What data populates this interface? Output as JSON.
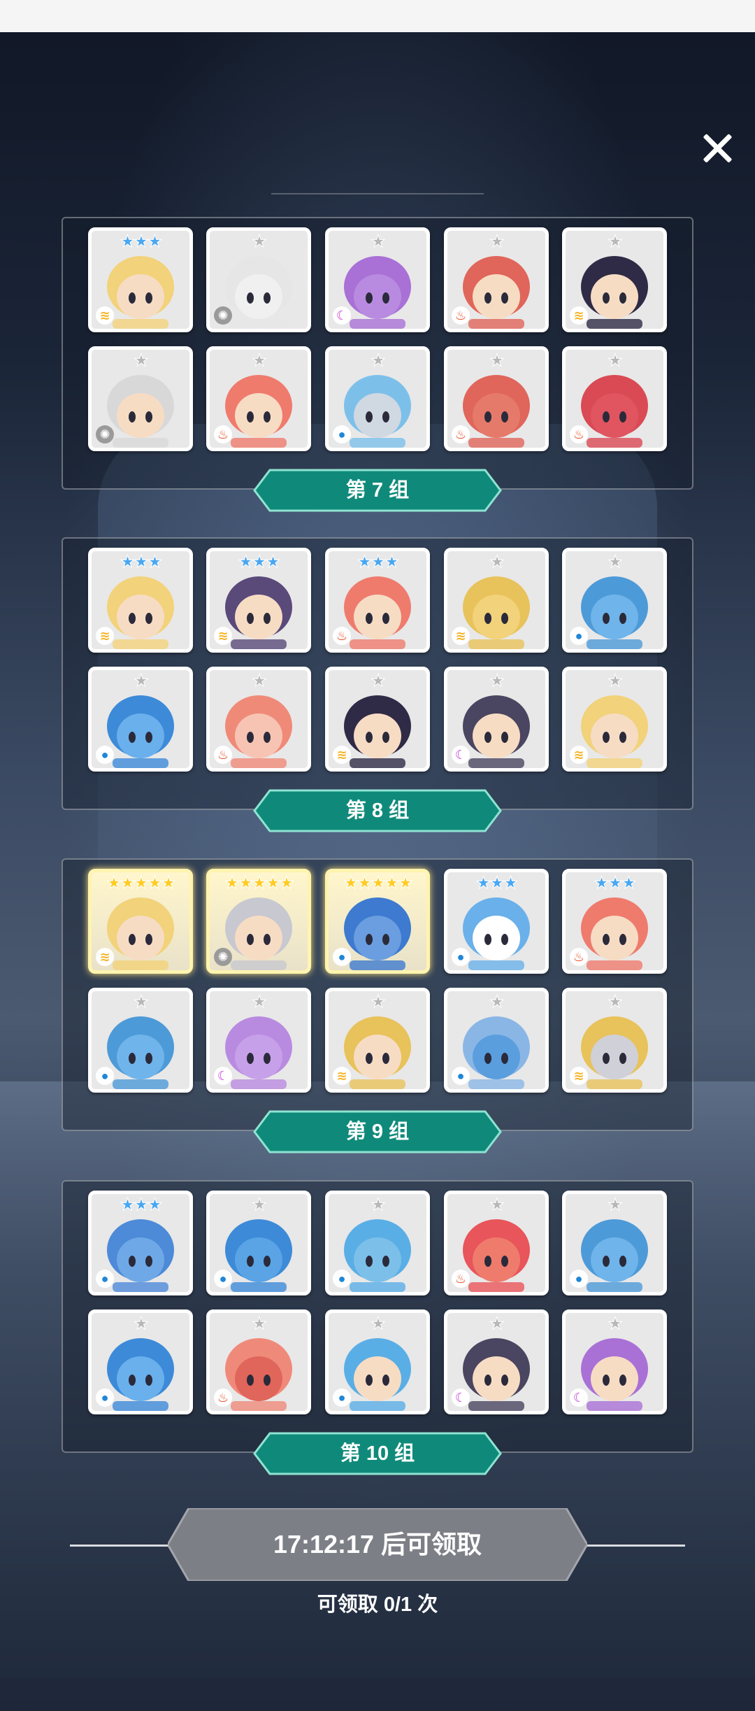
{
  "groups": [
    {
      "label": "第 7 组",
      "heroes": [
        {
          "stars": 3,
          "star_color": "blue",
          "element": "wind",
          "hair": "#f2d27a",
          "skin": "#f7dcc4"
        },
        {
          "stars": 1,
          "star_color": "gray",
          "element": "light",
          "hair": "#e6e6e6",
          "skin": "#f0f0f0"
        },
        {
          "stars": 1,
          "star_color": "gray",
          "element": "dark",
          "hair": "#a970d6",
          "skin": "#b98be0"
        },
        {
          "stars": 1,
          "star_color": "gray",
          "element": "fire",
          "hair": "#e0655a",
          "skin": "#f7dcc4"
        },
        {
          "stars": 1,
          "star_color": "gray",
          "element": "wind",
          "hair": "#2f2a45",
          "skin": "#f7dcc4"
        },
        {
          "stars": 1,
          "star_color": "gray",
          "element": "light",
          "hair": "#d8d8d8",
          "skin": "#f7dcc4"
        },
        {
          "stars": 1,
          "star_color": "gray",
          "element": "fire",
          "hair": "#ef7b6d",
          "skin": "#f7dcc4"
        },
        {
          "stars": 1,
          "star_color": "gray",
          "element": "water",
          "hair": "#7cc0ea",
          "skin": "#d0d8e2"
        },
        {
          "stars": 1,
          "star_color": "gray",
          "element": "fire",
          "hair": "#e0655a",
          "skin": "#e67a6a"
        },
        {
          "stars": 1,
          "star_color": "gray",
          "element": "fire",
          "hair": "#d94a55",
          "skin": "#e0555f"
        }
      ]
    },
    {
      "label": "第 8 组",
      "heroes": [
        {
          "stars": 3,
          "star_color": "blue",
          "element": "wind",
          "hair": "#f2d27a",
          "skin": "#f7dcc4"
        },
        {
          "stars": 3,
          "star_color": "blue",
          "element": "wind",
          "hair": "#5a4a7a",
          "skin": "#f7dcc4"
        },
        {
          "stars": 3,
          "star_color": "blue",
          "element": "fire",
          "hair": "#ef7b6d",
          "skin": "#f7dcc4"
        },
        {
          "stars": 1,
          "star_color": "gray",
          "element": "wind",
          "hair": "#e8c25a",
          "skin": "#f2d27a"
        },
        {
          "stars": 1,
          "star_color": "gray",
          "element": "water",
          "hair": "#4d9ad8",
          "skin": "#6fb4ea"
        },
        {
          "stars": 1,
          "star_color": "gray",
          "element": "water",
          "hair": "#3d8ad8",
          "skin": "#69b0ec"
        },
        {
          "stars": 1,
          "star_color": "gray",
          "element": "fire",
          "hair": "#f08a78",
          "skin": "#f7c4b4"
        },
        {
          "stars": 1,
          "star_color": "gray",
          "element": "wind",
          "hair": "#2f2a45",
          "skin": "#f7dcc4"
        },
        {
          "stars": 1,
          "star_color": "gray",
          "element": "dark",
          "hair": "#4a4560",
          "skin": "#f7dcc4"
        },
        {
          "stars": 1,
          "star_color": "gray",
          "element": "wind",
          "hair": "#f2d27a",
          "skin": "#f7dcc4"
        }
      ]
    },
    {
      "label": "第 9 组",
      "heroes": [
        {
          "stars": 5,
          "star_color": "gold",
          "element": "wind",
          "hair": "#f2d27a",
          "skin": "#f7dcc4",
          "gold": true
        },
        {
          "stars": 5,
          "star_color": "gold",
          "element": "light",
          "hair": "#c8c8d0",
          "skin": "#f7dcc4",
          "gold": true
        },
        {
          "stars": 5,
          "star_color": "gold",
          "element": "water",
          "hair": "#3d7ad0",
          "skin": "#6a9ee0",
          "gold": true
        },
        {
          "stars": 3,
          "star_color": "blue",
          "element": "water",
          "hair": "#6ab0ea",
          "skin": "#ffffff"
        },
        {
          "stars": 3,
          "star_color": "blue",
          "element": "fire",
          "hair": "#ef7b6d",
          "skin": "#f7dcc4"
        },
        {
          "stars": 1,
          "star_color": "gray",
          "element": "water",
          "hair": "#4d9ad8",
          "skin": "#6fb4ea"
        },
        {
          "stars": 1,
          "star_color": "gray",
          "element": "dark",
          "hair": "#b98be0",
          "skin": "#c7a0ea"
        },
        {
          "stars": 1,
          "star_color": "gray",
          "element": "wind",
          "hair": "#e8c25a",
          "skin": "#f7dcc4"
        },
        {
          "stars": 1,
          "star_color": "gray",
          "element": "water",
          "hair": "#8ab6e6",
          "skin": "#5a9ede"
        },
        {
          "stars": 1,
          "star_color": "gray",
          "element": "wind",
          "hair": "#e8c25a",
          "skin": "#d0d0d8"
        }
      ]
    },
    {
      "label": "第 10 组",
      "heroes": [
        {
          "stars": 3,
          "star_color": "blue",
          "element": "water",
          "hair": "#4d8ad8",
          "skin": "#6fa8e6"
        },
        {
          "stars": 1,
          "star_color": "gray",
          "element": "water",
          "hair": "#3d8ad8",
          "skin": "#5aa4e6"
        },
        {
          "stars": 1,
          "star_color": "gray",
          "element": "water",
          "hair": "#5aaee6",
          "skin": "#7cc0ea"
        },
        {
          "stars": 1,
          "star_color": "gray",
          "element": "fire",
          "hair": "#e8555a",
          "skin": "#ef7b6d"
        },
        {
          "stars": 1,
          "star_color": "gray",
          "element": "water",
          "hair": "#4d9ad8",
          "skin": "#6fb4ea"
        },
        {
          "stars": 1,
          "star_color": "gray",
          "element": "water",
          "hair": "#3d8ad8",
          "skin": "#69b0ec"
        },
        {
          "stars": 1,
          "star_color": "gray",
          "element": "fire",
          "hair": "#ef8a7a",
          "skin": "#e0655a"
        },
        {
          "stars": 1,
          "star_color": "gray",
          "element": "water",
          "hair": "#5aaee6",
          "skin": "#f7dcc4"
        },
        {
          "stars": 1,
          "star_color": "gray",
          "element": "dark",
          "hair": "#4a4560",
          "skin": "#f7dcc4"
        },
        {
          "stars": 1,
          "star_color": "gray",
          "element": "dark",
          "hair": "#a970d6",
          "skin": "#f7dcc4"
        }
      ]
    }
  ],
  "claim": {
    "button_label": "17:12:17 后可领取",
    "count_label": "可领取 0/1 次"
  },
  "colors": {
    "group_tag": "#0f8a7a",
    "claim_button": "#7d7f86",
    "background": "#141b2b"
  },
  "icons": {
    "close": "close-icon",
    "star": "star-icon",
    "elements": {
      "light": "sun-icon",
      "wind": "wind-icon",
      "fire": "fire-icon",
      "water": "water-drop-icon",
      "dark": "moon-icon"
    }
  }
}
